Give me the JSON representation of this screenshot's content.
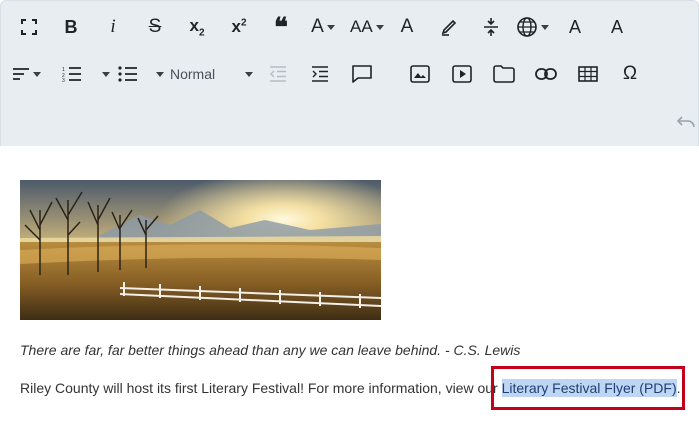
{
  "toolbar": {
    "row1": [
      {
        "name": "fullscreen",
        "label": ""
      },
      {
        "name": "bold",
        "label": "B"
      },
      {
        "name": "italic",
        "label": "i"
      },
      {
        "name": "strikethrough",
        "label": "S"
      },
      {
        "name": "subscript",
        "label": "x",
        "sub": "2"
      },
      {
        "name": "superscript",
        "label": "x",
        "sup": "2"
      },
      {
        "name": "blockquote",
        "label": "❝"
      },
      {
        "name": "font-family",
        "label": "A"
      },
      {
        "name": "font-size",
        "label": "AA"
      },
      {
        "name": "text-color",
        "label": "A"
      },
      {
        "name": "highlight",
        "label": ""
      },
      {
        "name": "line-height",
        "label": ""
      },
      {
        "name": "language",
        "label": ""
      },
      {
        "name": "clear-format",
        "label": "A"
      },
      {
        "name": "spellcheck",
        "label": "A"
      }
    ],
    "format_label": "Normal",
    "row2": [
      {
        "name": "align"
      },
      {
        "name": "ordered-list"
      },
      {
        "name": "bullet-list"
      },
      {
        "name": "outdent"
      },
      {
        "name": "indent"
      },
      {
        "name": "comment"
      },
      {
        "name": "insert-image"
      },
      {
        "name": "insert-video"
      },
      {
        "name": "insert-file"
      },
      {
        "name": "insert-link"
      },
      {
        "name": "insert-table"
      },
      {
        "name": "special-char",
        "label": "Ω"
      }
    ]
  },
  "content": {
    "quote": "There are far, far better things ahead than any we can leave behind. - C.S. Lewis",
    "paragraph_prefix": "Riley County will host its first Literary Festival! For more information, view our ",
    "link_text": "Literary Festival Flyer (PDF)",
    "paragraph_suffix": "."
  },
  "colors": {
    "toolbar_bg": "#e8edf2",
    "link_highlight": "#bed6f3",
    "callout_border": "#c4001a"
  }
}
